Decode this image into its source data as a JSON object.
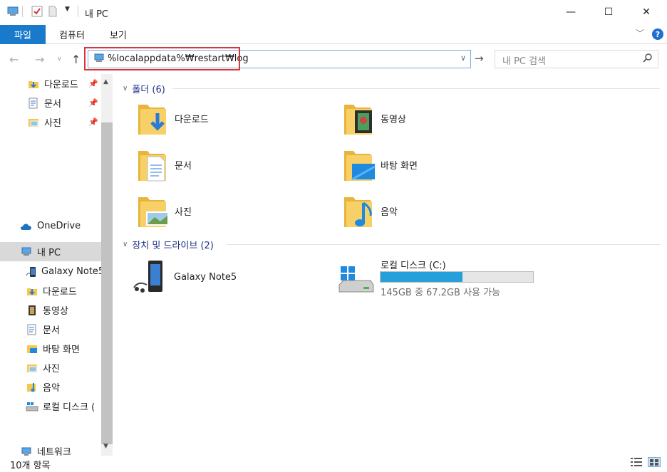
{
  "window": {
    "title": "내 PC",
    "minimize": "—",
    "maximize": "☐",
    "close": "✕"
  },
  "ribbon": {
    "tabs": [
      {
        "label": "파일",
        "active": true
      },
      {
        "label": "컴퓨터",
        "active": false
      },
      {
        "label": "보기",
        "active": false
      }
    ],
    "help": "?"
  },
  "address": {
    "value": "%localappdata%₩restart₩log",
    "search_placeholder": "내 PC 검색"
  },
  "sidebar": {
    "quick_access": [
      {
        "label": "다운로드",
        "icon": "download-folder-icon",
        "pinned": true
      },
      {
        "label": "문서",
        "icon": "documents-folder-icon",
        "pinned": true
      },
      {
        "label": "사진",
        "icon": "pictures-folder-icon",
        "pinned": true
      }
    ],
    "onedrive": "OneDrive",
    "this_pc": "내 PC",
    "pc_items": [
      {
        "label": "Galaxy Note5",
        "icon": "phone-icon"
      },
      {
        "label": "다운로드",
        "icon": "download-folder-icon"
      },
      {
        "label": "동영상",
        "icon": "videos-folder-icon"
      },
      {
        "label": "문서",
        "icon": "documents-folder-icon"
      },
      {
        "label": "바탕 화면",
        "icon": "desktop-folder-icon"
      },
      {
        "label": "사진",
        "icon": "pictures-folder-icon"
      },
      {
        "label": "음악",
        "icon": "music-folder-icon"
      },
      {
        "label": "로컬 디스크 (",
        "icon": "drive-icon"
      }
    ],
    "network": "네트워크"
  },
  "content": {
    "folders_header": "폴더 (6)",
    "folders": [
      {
        "label": "다운로드",
        "icon": "download-folder-icon"
      },
      {
        "label": "동영상",
        "icon": "videos-folder-icon"
      },
      {
        "label": "문서",
        "icon": "documents-folder-icon"
      },
      {
        "label": "바탕 화면",
        "icon": "desktop-folder-icon"
      },
      {
        "label": "사진",
        "icon": "pictures-folder-icon"
      },
      {
        "label": "음악",
        "icon": "music-folder-icon"
      }
    ],
    "devices_header": "장치 및 드라이브 (2)",
    "devices": [
      {
        "label": "Galaxy Note5",
        "icon": "phone-icon"
      },
      {
        "label": "로컬 디스크 (C:)",
        "icon": "drive-icon",
        "free_text": "145GB 중 67.2GB 사용 가능",
        "used_fraction": 0.537
      }
    ]
  },
  "status": {
    "item_count": "10개 항목"
  },
  "colors": {
    "accent": "#1979ca",
    "highlight_border": "#d8343b",
    "drive_fill": "#26a0da",
    "group_header": "#1e3287"
  }
}
